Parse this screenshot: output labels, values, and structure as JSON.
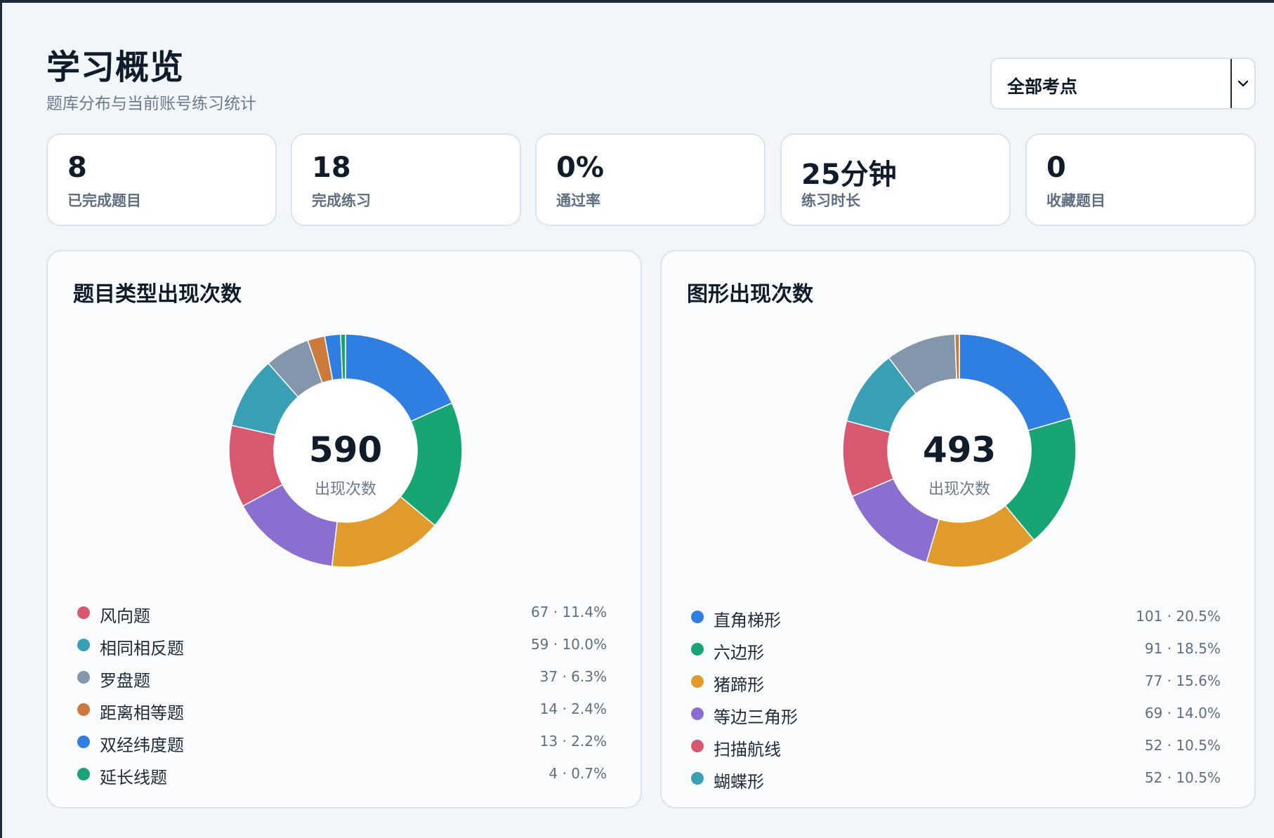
{
  "header": {
    "title": "学习概览",
    "subtitle": "题库分布与当前账号练习统计",
    "filter_selected": "全部考点"
  },
  "stats": [
    {
      "value": "8",
      "label": "已完成题目"
    },
    {
      "value": "18",
      "label": "完成练习"
    },
    {
      "value": "0%",
      "label": "通过率"
    },
    {
      "value": "25分钟",
      "label": "练习时长"
    },
    {
      "value": "0",
      "label": "收藏题目"
    }
  ],
  "colors": {
    "blue": "#2f7fe3",
    "green": "#17a673",
    "orange": "#e19b2d",
    "purple": "#8a6fd1",
    "red": "#d8596f",
    "teal": "#389fb5",
    "slate": "#8396ac",
    "brown": "#cc7a3b"
  },
  "chart_data": [
    {
      "type": "pie",
      "title": "题目类型出现次数",
      "center_value": "590",
      "center_label": "出现次数",
      "total": 590,
      "slices_clockwise_from_top": [
        {
          "value": 108,
          "color": "#2f7fe3"
        },
        {
          "value": 105,
          "color": "#17a673"
        },
        {
          "value": 93,
          "color": "#e19b2d"
        },
        {
          "value": 90,
          "color": "#8a6fd1"
        },
        {
          "value": 67,
          "color": "#d8596f"
        },
        {
          "value": 59,
          "color": "#389fb5"
        },
        {
          "value": 37,
          "color": "#8396ac"
        },
        {
          "value": 14,
          "color": "#cc7a3b"
        },
        {
          "value": 13,
          "color": "#2f7fe3"
        },
        {
          "value": 4,
          "color": "#17a673"
        }
      ],
      "legend": [
        {
          "name": "风向题",
          "value": "67 · 11.4%",
          "color": "#d8596f"
        },
        {
          "name": "相同相反题",
          "value": "59 · 10.0%",
          "color": "#389fb5"
        },
        {
          "name": "罗盘题",
          "value": "37 · 6.3%",
          "color": "#8396ac"
        },
        {
          "name": "距离相等题",
          "value": "14 · 2.4%",
          "color": "#cc7a3b"
        },
        {
          "name": "双经纬度题",
          "value": "13 · 2.2%",
          "color": "#2f7fe3"
        },
        {
          "name": "延长线题",
          "value": "4 · 0.7%",
          "color": "#17a673"
        }
      ]
    },
    {
      "type": "pie",
      "title": "图形出现次数",
      "center_value": "493",
      "center_label": "出现次数",
      "total": 493,
      "slices_clockwise_from_top": [
        {
          "value": 101,
          "color": "#2f7fe3"
        },
        {
          "value": 91,
          "color": "#17a673"
        },
        {
          "value": 77,
          "color": "#e19b2d"
        },
        {
          "value": 69,
          "color": "#8a6fd1"
        },
        {
          "value": 52,
          "color": "#d8596f"
        },
        {
          "value": 52,
          "color": "#389fb5"
        },
        {
          "value": 48,
          "color": "#8396ac"
        },
        {
          "value": 3,
          "color": "#cc7a3b"
        }
      ],
      "legend": [
        {
          "name": "直角梯形",
          "value": "101 · 20.5%",
          "color": "#2f7fe3"
        },
        {
          "name": "六边形",
          "value": "91 · 18.5%",
          "color": "#17a673"
        },
        {
          "name": "猪蹄形",
          "value": "77 · 15.6%",
          "color": "#e19b2d"
        },
        {
          "name": "等边三角形",
          "value": "69 · 14.0%",
          "color": "#8a6fd1"
        },
        {
          "name": "扫描航线",
          "value": "52 · 10.5%",
          "color": "#d8596f"
        },
        {
          "name": "蝴蝶形",
          "value": "52 · 10.5%",
          "color": "#389fb5"
        }
      ]
    }
  ]
}
